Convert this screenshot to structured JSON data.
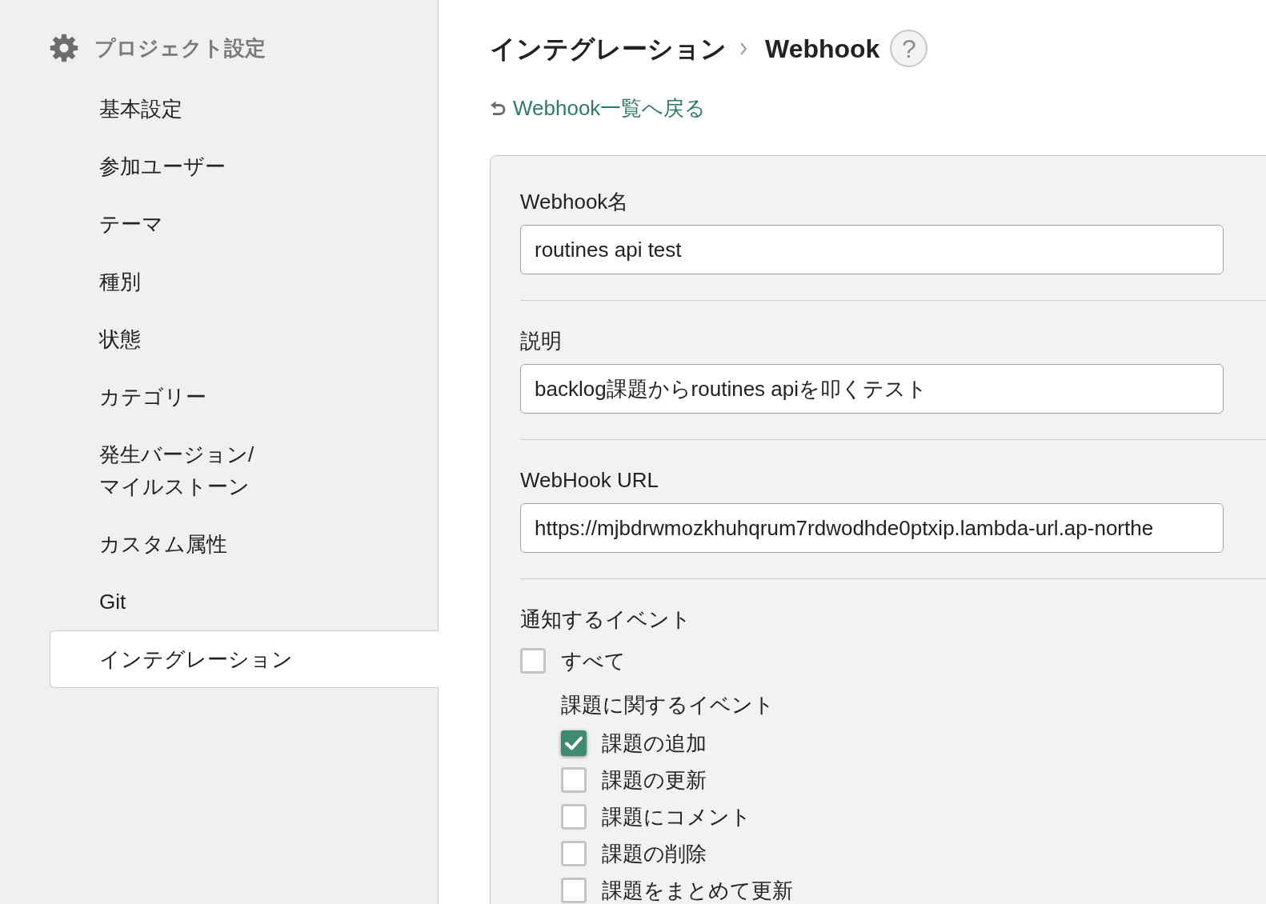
{
  "sidebar": {
    "title": "プロジェクト設定",
    "items": [
      {
        "label": "基本設定",
        "selected": false
      },
      {
        "label": "参加ユーザー",
        "selected": false
      },
      {
        "label": "テーマ",
        "selected": false
      },
      {
        "label": "種別",
        "selected": false
      },
      {
        "label": "状態",
        "selected": false
      },
      {
        "label": "カテゴリー",
        "selected": false
      },
      {
        "label": "発生バージョン/\nマイルストーン",
        "selected": false
      },
      {
        "label": "カスタム属性",
        "selected": false
      },
      {
        "label": "Git",
        "selected": false
      },
      {
        "label": "インテグレーション",
        "selected": true
      }
    ]
  },
  "breadcrumb": {
    "items": [
      "インテグレーション",
      "Webhook"
    ],
    "help": "?"
  },
  "back_link": "Webhook一覧へ戻る",
  "form": {
    "fields": [
      {
        "label": "Webhook名",
        "value": "routines api test"
      },
      {
        "label": "説明",
        "value": "backlog課題からroutines apiを叩くテスト"
      },
      {
        "label": "WebHook URL",
        "value": "https://mjbdrwmozkhuhqrum7rdwodhde0ptxip.lambda-url.ap-northe"
      }
    ],
    "events": {
      "label": "通知するイベント",
      "all": {
        "label": "すべて",
        "checked": false
      },
      "groups": [
        {
          "title": "課題に関するイベント",
          "items": [
            {
              "label": "課題の追加",
              "checked": true
            },
            {
              "label": "課題の更新",
              "checked": false
            },
            {
              "label": "課題にコメント",
              "checked": false
            },
            {
              "label": "課題の削除",
              "checked": false
            },
            {
              "label": "課題をまとめて更新",
              "checked": false
            }
          ]
        }
      ]
    }
  }
}
